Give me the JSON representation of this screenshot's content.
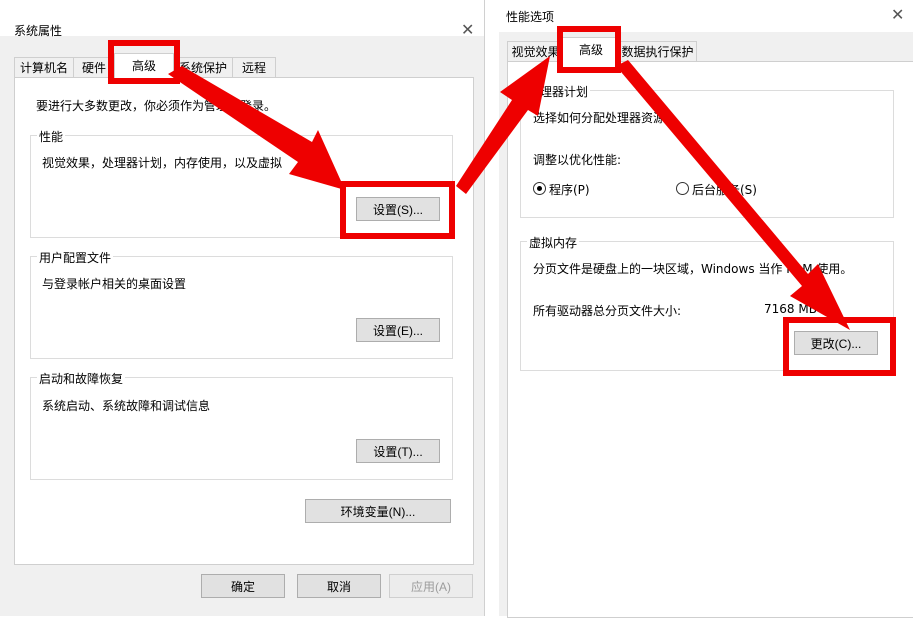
{
  "system_properties": {
    "title": "系统属性",
    "tabs": [
      "计算机名",
      "硬件",
      "高级",
      "系统保护",
      "远程"
    ],
    "admin_note": "要进行大多数更改，你必须作为管理员登录。",
    "performance": {
      "title": "性能",
      "desc": "视觉效果，处理器计划，内存使用，以及虚拟",
      "button": "设置(S)..."
    },
    "user_profiles": {
      "title": "用户配置文件",
      "desc": "与登录帐户相关的桌面设置",
      "button": "设置(E)..."
    },
    "startup_recovery": {
      "title": "启动和故障恢复",
      "desc": "系统启动、系统故障和调试信息",
      "button": "设置(T)..."
    },
    "env_button": "环境变量(N)...",
    "ok": "确定",
    "cancel": "取消",
    "apply": "应用(A)"
  },
  "performance_options": {
    "title": "性能选项",
    "tabs": [
      "视觉效果",
      "高级",
      "数据执行保护"
    ],
    "processor": {
      "title": "理器计划",
      "desc": "选择如何分配处理器资源。",
      "optimize_label": "调整以优化性能:",
      "opt_programs": "程序(P)",
      "opt_background": "后台服务(S)"
    },
    "virtual_memory": {
      "title": "虚拟内存",
      "desc": "分页文件是硬盘上的一块区域，Windows 当作 RAM 使用。",
      "total_label": "所有驱动器总分页文件大小:",
      "total_value": "7168 MB",
      "change_button": "更改(C)..."
    }
  },
  "colors": {
    "annotation": "#ee0000"
  }
}
